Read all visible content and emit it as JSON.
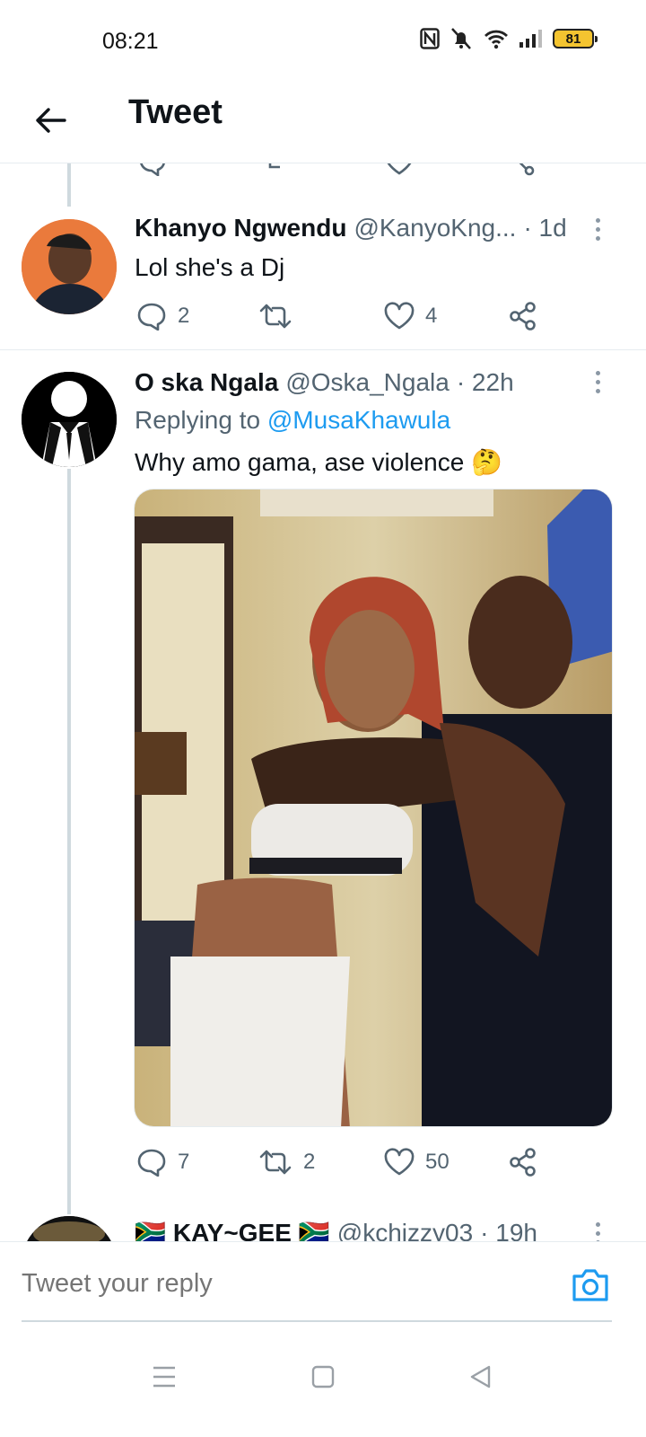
{
  "status_bar": {
    "time": "08:21",
    "battery": "81"
  },
  "header": {
    "title": "Tweet"
  },
  "tweets": [
    {
      "display_name": "Khanyo Ngwendu",
      "handle": "@KanyoKng...",
      "time": "· 1d",
      "text": "Lol she's a Dj",
      "replies": "2",
      "retweets": "",
      "likes": "4"
    },
    {
      "display_name": "O ska Ngala",
      "handle": "@Oska_Ngala",
      "time": "· 22h",
      "replying_prefix": "Replying to",
      "replying_handle": "@MusaKhawula",
      "text": "Why amo gama, ase violence 🤔",
      "replies": "7",
      "retweets": "2",
      "likes": "50"
    },
    {
      "display_name": "KAY~GEE",
      "flag": "🇿🇦",
      "handle": "@kchizzy03",
      "time": "· 19h"
    }
  ],
  "reply_bar": {
    "placeholder": "Tweet your reply"
  },
  "icons": {
    "back": "arrow-left-icon",
    "reply": "speech-bubble-icon",
    "retweet": "retweet-icon",
    "like": "heart-icon",
    "share": "share-icon",
    "camera": "camera-icon"
  },
  "colors": {
    "link": "#1d9bf0",
    "secondary_text": "#536471",
    "thread_line": "#cfd9de"
  }
}
